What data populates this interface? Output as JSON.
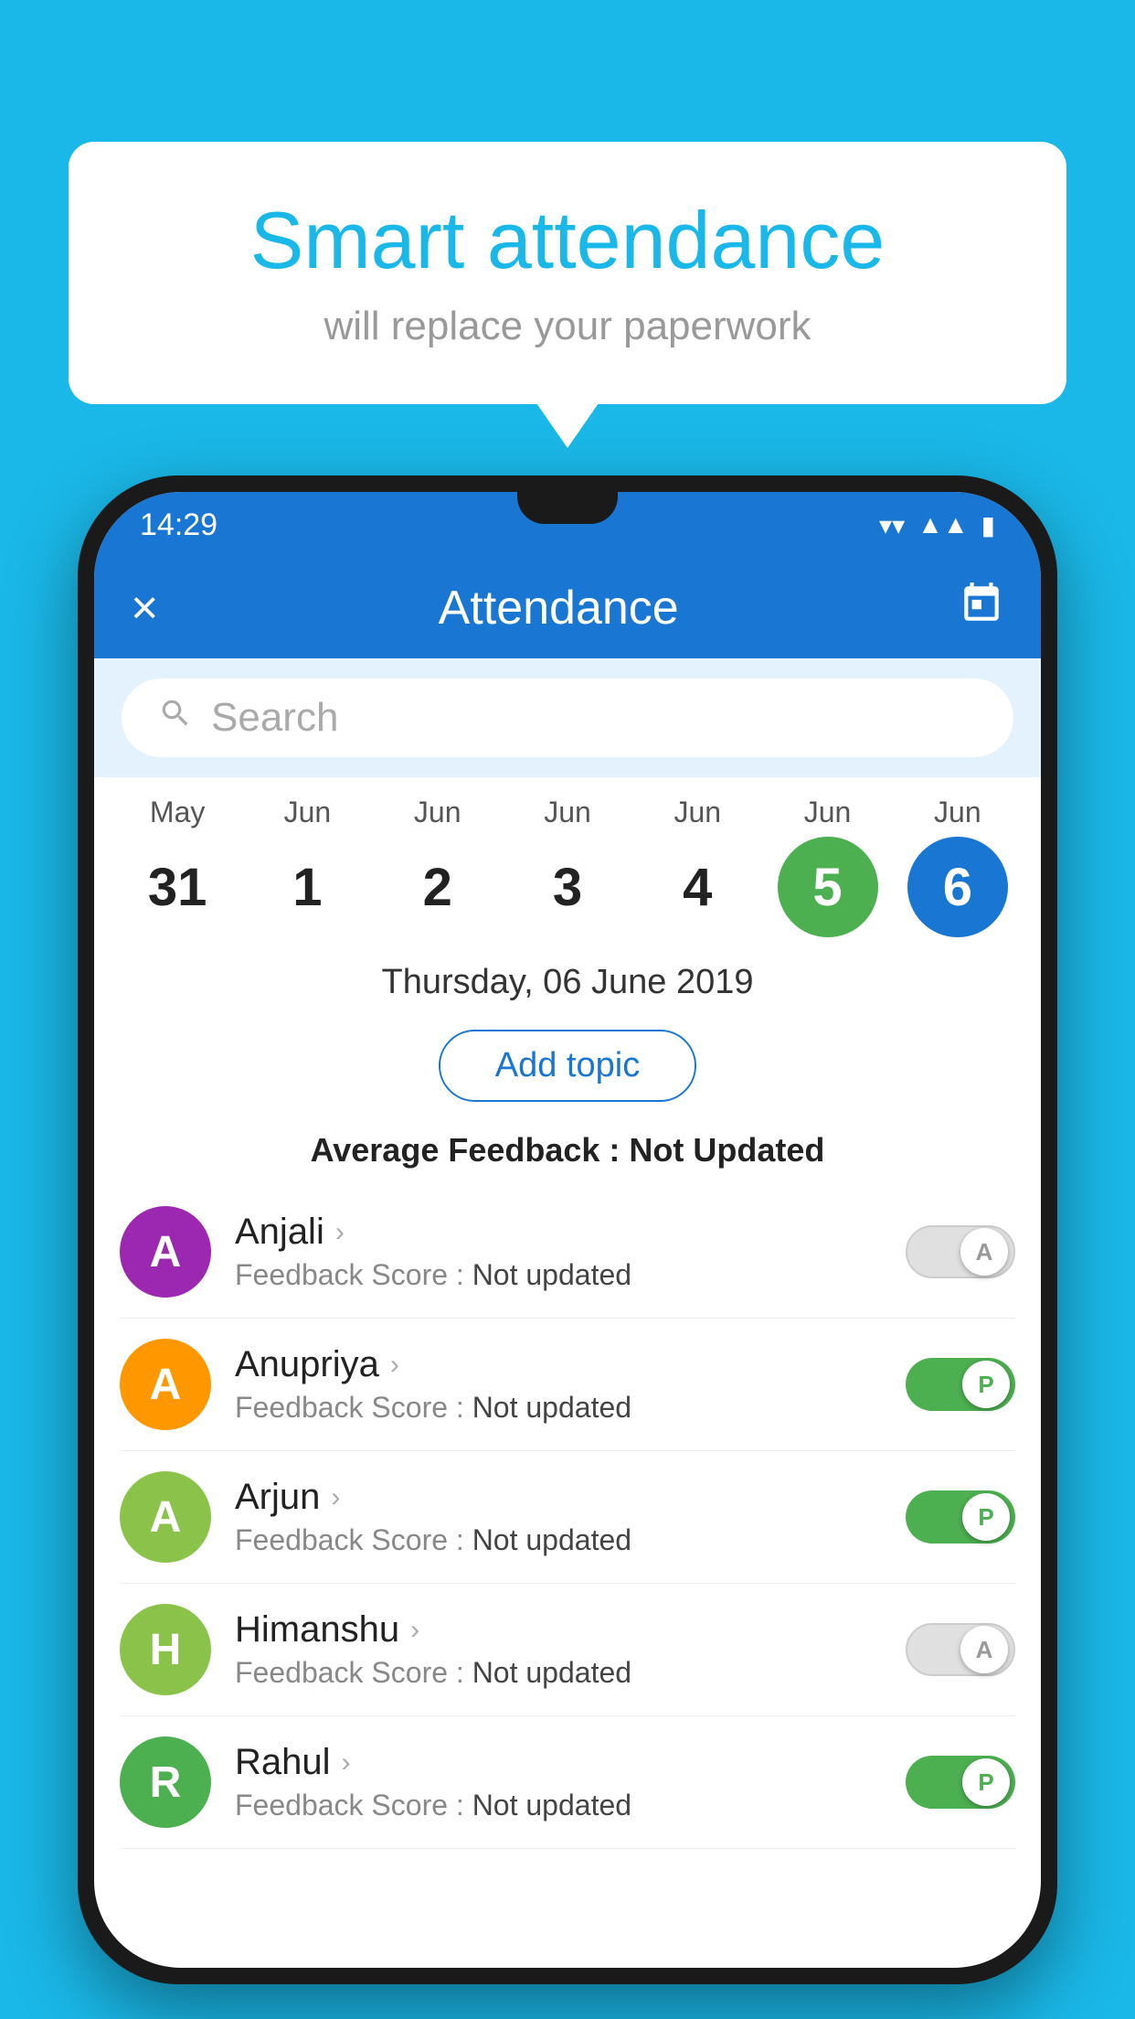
{
  "background_color": "#1ab8e8",
  "bubble": {
    "title": "Smart attendance",
    "subtitle": "will replace your paperwork"
  },
  "status_bar": {
    "time": "14:29",
    "wifi": "▼",
    "signal": "▲",
    "battery": "▮"
  },
  "app_bar": {
    "title": "Attendance",
    "close_label": "×",
    "calendar_icon": "📅"
  },
  "search": {
    "placeholder": "Search"
  },
  "calendar": {
    "days": [
      {
        "month": "May",
        "date": "31",
        "state": "normal"
      },
      {
        "month": "Jun",
        "date": "1",
        "state": "normal"
      },
      {
        "month": "Jun",
        "date": "2",
        "state": "normal"
      },
      {
        "month": "Jun",
        "date": "3",
        "state": "normal"
      },
      {
        "month": "Jun",
        "date": "4",
        "state": "normal"
      },
      {
        "month": "Jun",
        "date": "5",
        "state": "today"
      },
      {
        "month": "Jun",
        "date": "6",
        "state": "selected"
      }
    ]
  },
  "selected_date": "Thursday, 06 June 2019",
  "add_topic_label": "Add topic",
  "avg_feedback_label": "Average Feedback : ",
  "avg_feedback_value": "Not Updated",
  "students": [
    {
      "name": "Anjali",
      "avatar_letter": "A",
      "avatar_color": "#9c27b0",
      "score_label": "Feedback Score : ",
      "score_value": "Not updated",
      "toggle": "off",
      "toggle_label": "A"
    },
    {
      "name": "Anupriya",
      "avatar_letter": "A",
      "avatar_color": "#ff9800",
      "score_label": "Feedback Score : ",
      "score_value": "Not updated",
      "toggle": "on",
      "toggle_label": "P"
    },
    {
      "name": "Arjun",
      "avatar_letter": "A",
      "avatar_color": "#8bc34a",
      "score_label": "Feedback Score : ",
      "score_value": "Not updated",
      "toggle": "on",
      "toggle_label": "P"
    },
    {
      "name": "Himanshu",
      "avatar_letter": "H",
      "avatar_color": "#8bc34a",
      "score_label": "Feedback Score : ",
      "score_value": "Not updated",
      "toggle": "off",
      "toggle_label": "A"
    },
    {
      "name": "Rahul",
      "avatar_letter": "R",
      "avatar_color": "#4caf50",
      "score_label": "Feedback Score : ",
      "score_value": "Not updated",
      "toggle": "on",
      "toggle_label": "P"
    }
  ]
}
